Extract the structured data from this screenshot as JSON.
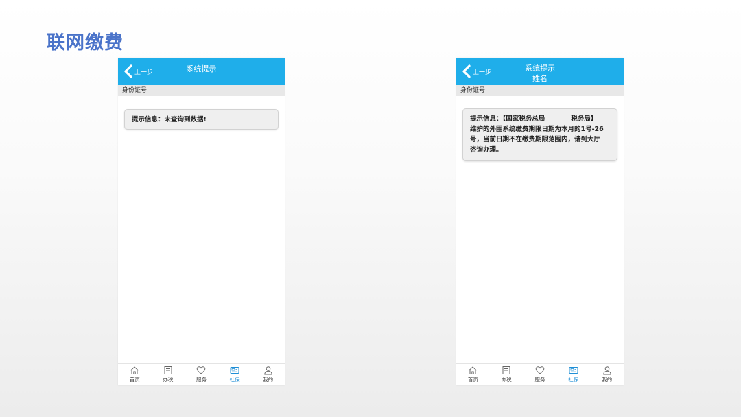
{
  "slide": {
    "title": "联网缴费"
  },
  "screens": [
    {
      "nav": {
        "back_label": "上一步",
        "title": "系统提示",
        "subtitle": ""
      },
      "id_label": "身份证号:",
      "message": {
        "lines": [
          "提示信息：未查询到数据!"
        ]
      }
    },
    {
      "nav": {
        "back_label": "上一步",
        "title": "系统提示",
        "subtitle": "姓名"
      },
      "id_label": "身份证号:",
      "message": {
        "line1_a": "提示信息：【国家税务总局",
        "line1_b": "税务局】",
        "lines": [
          "维护的外围系统缴费期限日期为本月的1号-26",
          "号，当前日期不在缴费期限范围内，请到大厅",
          "咨询办理。"
        ]
      }
    }
  ],
  "tabbar": {
    "items": [
      {
        "label": "首页",
        "icon": "home-icon"
      },
      {
        "label": "办税",
        "icon": "list-icon"
      },
      {
        "label": "服务",
        "icon": "heart-icon"
      },
      {
        "label": "社保",
        "icon": "card-icon"
      },
      {
        "label": "我的",
        "icon": "user-icon"
      }
    ],
    "active_index": 3
  },
  "colors": {
    "title": "#4a73c9",
    "navbar": "#1faeea",
    "active_tab": "#1f8fd6"
  }
}
